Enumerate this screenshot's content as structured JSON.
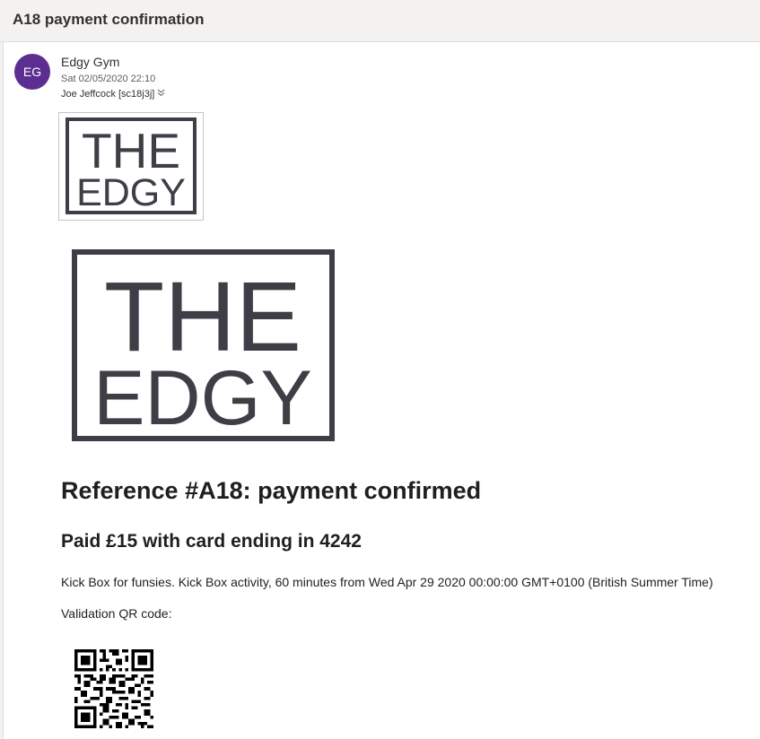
{
  "subject": "A18 payment confirmation",
  "sender": {
    "initials": "EG",
    "name": "Edgy Gym",
    "avatar_color": "#5c2e91",
    "datetime": "Sat 02/05/2020 22:10",
    "recipient": "Joe Jeffcock [sc18j3j]",
    "expand_icon": "chevron-double-down-icon"
  },
  "logo": {
    "line1": "THE",
    "line2": "EDGY",
    "color": "#3f3e46"
  },
  "body": {
    "heading": "Reference #A18: payment confirmed",
    "paid": "Paid £15 with card ending in 4242",
    "description": "Kick Box for funsies. Kick Box activity, 60 minutes from Wed Apr 29 2020 00:00:00 GMT+0100 (British Summer Time)",
    "qr_label": "Validation QR code:"
  }
}
